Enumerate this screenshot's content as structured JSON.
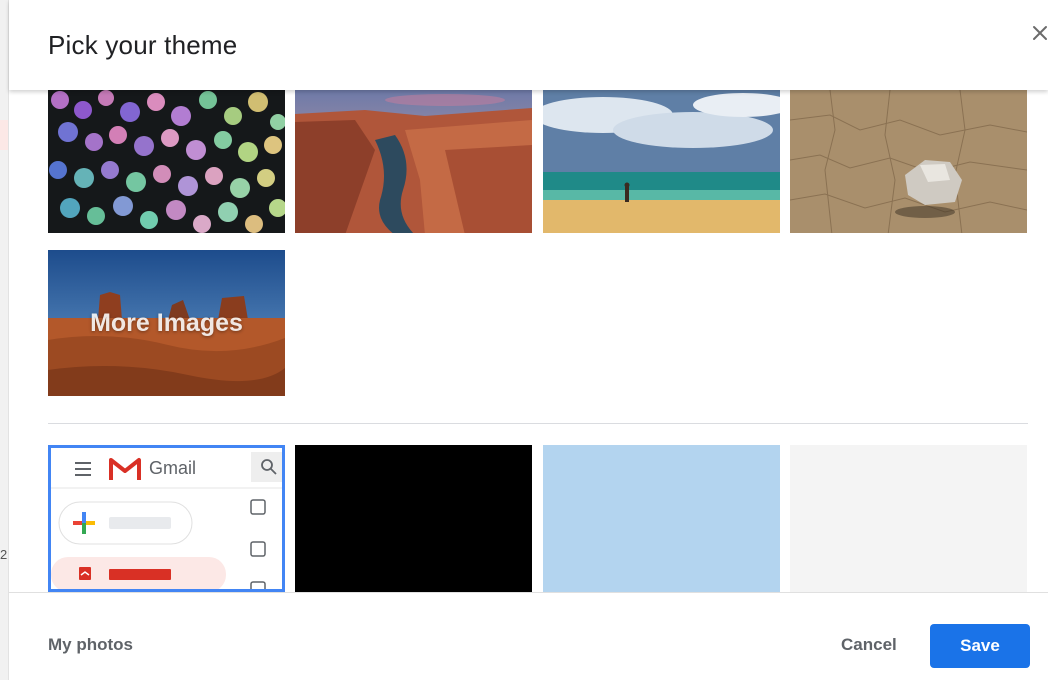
{
  "dialog": {
    "title": "Pick your theme",
    "close_icon": "close-icon"
  },
  "themes": {
    "images": [
      {
        "name": "bokeh-lights"
      },
      {
        "name": "canyon-river"
      },
      {
        "name": "beach"
      },
      {
        "name": "cracked-desert-rock"
      }
    ],
    "more_images_label": "More Images",
    "colors": [
      {
        "name": "default",
        "color": "#ffffff"
      },
      {
        "name": "black",
        "color": "#000000"
      },
      {
        "name": "light-blue",
        "color": "#b3d4ef"
      },
      {
        "name": "light-gray",
        "color": "#f4f4f4"
      }
    ]
  },
  "default_preview": {
    "app_name": "Gmail",
    "selected_border_color": "#4285f4"
  },
  "footer": {
    "my_photos": "My photos",
    "cancel": "Cancel",
    "save": "Save"
  },
  "background_page": {
    "digit": "2"
  },
  "colors": {
    "accent": "#1a73e8",
    "text_secondary": "#5f6368"
  }
}
